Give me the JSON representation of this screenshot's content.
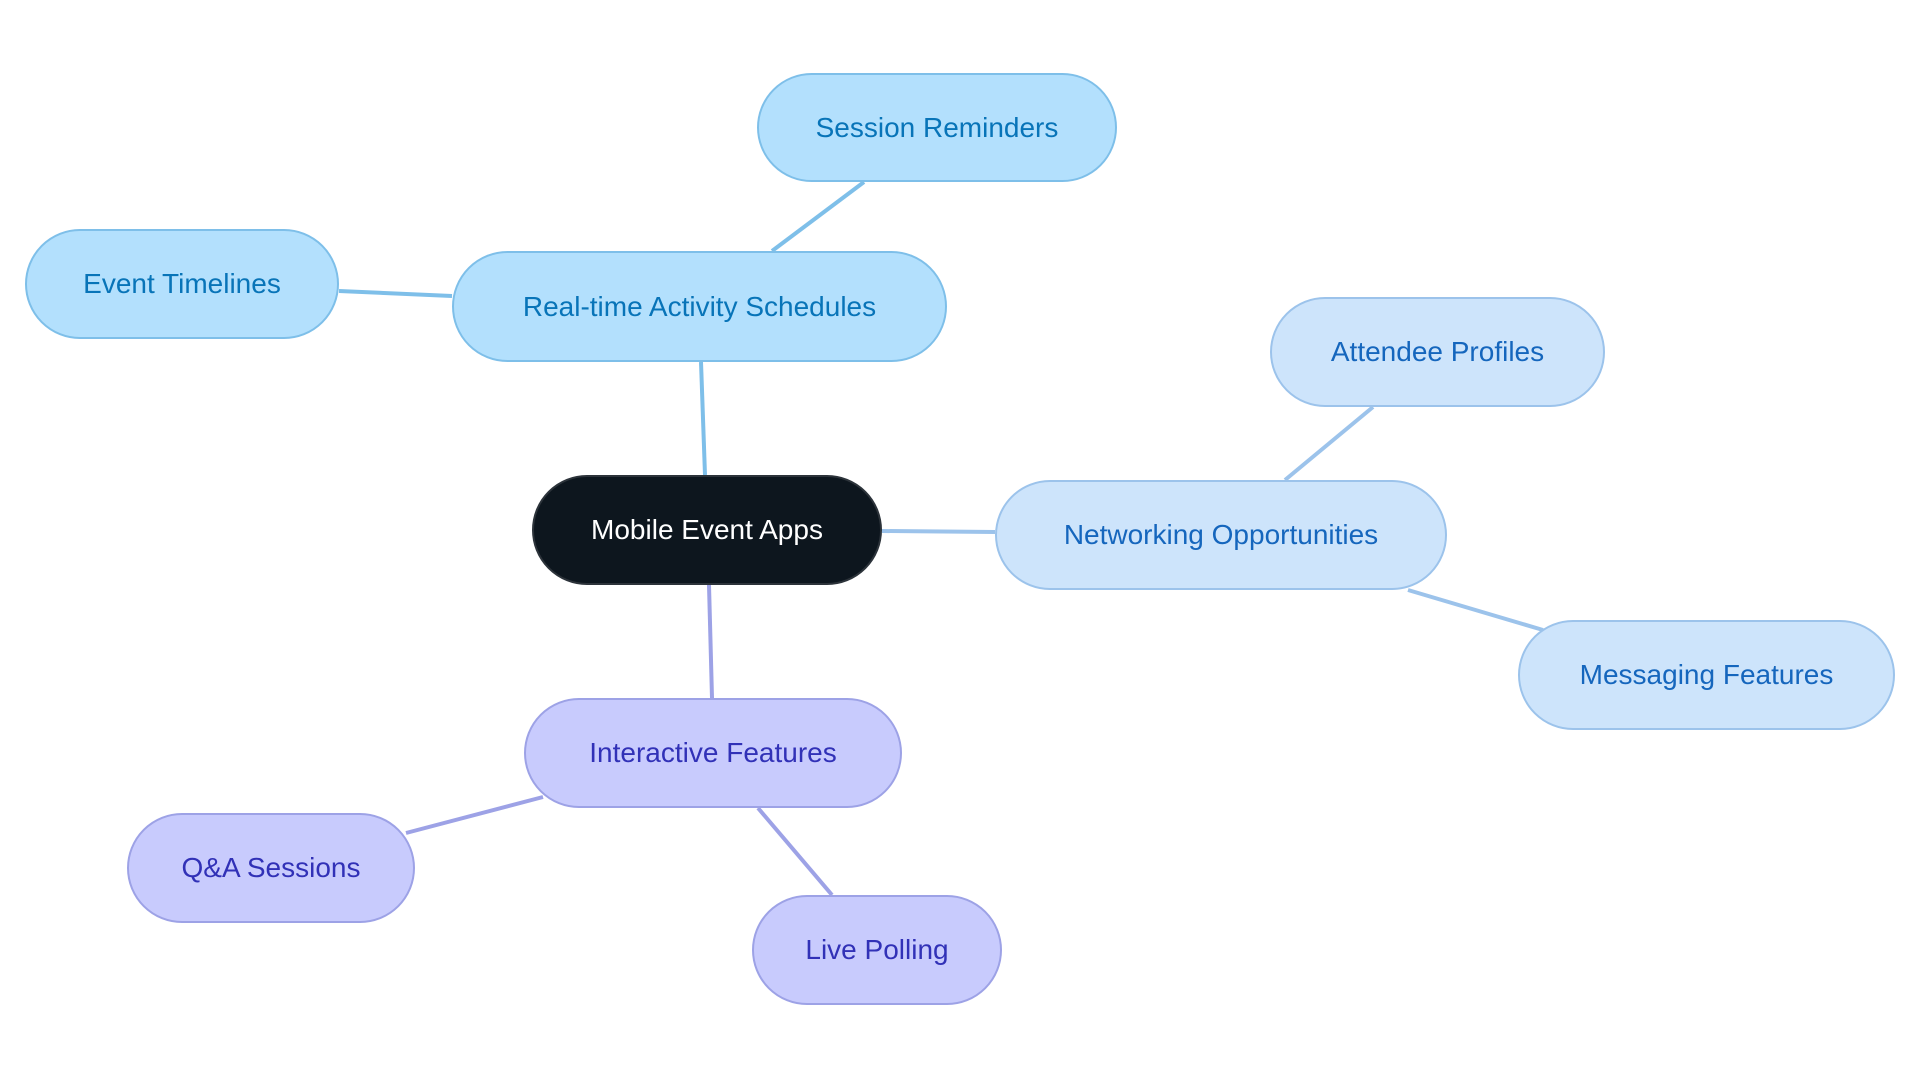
{
  "diagram": {
    "type": "mind-map",
    "root": {
      "id": "root",
      "label": "Mobile Event Apps",
      "theme": "root"
    },
    "nodes": [
      {
        "id": "realtime",
        "label": "Real-time Activity Schedules",
        "parent": "root",
        "theme": "sky"
      },
      {
        "id": "session",
        "label": "Session Reminders",
        "parent": "realtime",
        "theme": "sky"
      },
      {
        "id": "timelines",
        "label": "Event Timelines",
        "parent": "realtime",
        "theme": "sky"
      },
      {
        "id": "networking",
        "label": "Networking Opportunities",
        "parent": "root",
        "theme": "blue"
      },
      {
        "id": "attendee",
        "label": "Attendee Profiles",
        "parent": "networking",
        "theme": "blue"
      },
      {
        "id": "messaging",
        "label": "Messaging Features",
        "parent": "networking",
        "theme": "blue"
      },
      {
        "id": "interactive",
        "label": "Interactive Features",
        "parent": "root",
        "theme": "violet"
      },
      {
        "id": "qa",
        "label": "Q&A Sessions",
        "parent": "interactive",
        "theme": "violet"
      },
      {
        "id": "polling",
        "label": "Live Polling",
        "parent": "interactive",
        "theme": "violet"
      }
    ],
    "colors": {
      "root_fill": "#0d161e",
      "root_text": "#ffffff",
      "sky_fill": "#b3e0fd",
      "sky_edge": "#7ebfe9",
      "sky_text": "#0874b8",
      "blue_fill": "#cde4fb",
      "blue_edge": "#9cc3eb",
      "blue_text": "#1566bd",
      "violet_fill": "#c8cbfd",
      "violet_edge": "#9da2e6",
      "violet_text": "#3131b7"
    }
  }
}
